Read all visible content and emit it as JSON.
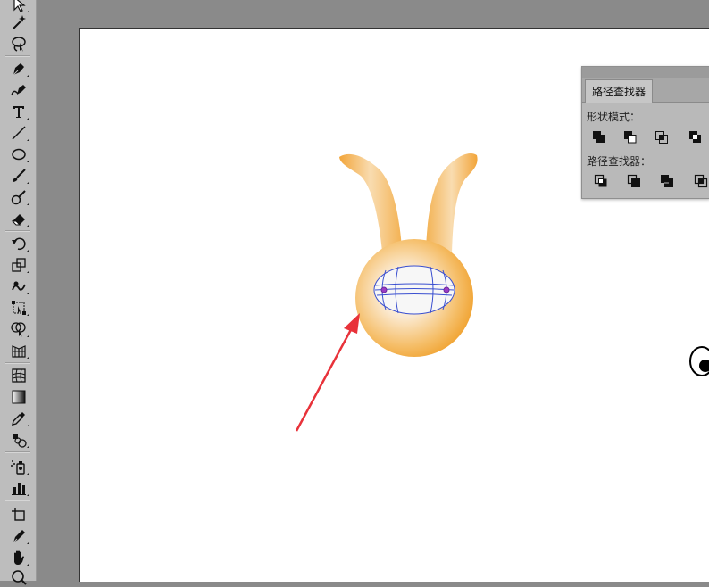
{
  "pathfinder": {
    "tab_label": "路径查找器",
    "shape_modes_label": "形状模式：",
    "pathfinders_label": "路径查找器："
  },
  "toolbar": {
    "tools": [
      "selection-tool",
      "magic-wand-tool",
      "lasso-tool",
      "pen-tool",
      "curvature-tool",
      "type-tool",
      "line-segment-tool",
      "ellipse-tool",
      "paintbrush-tool",
      "blob-brush-tool",
      "eraser-tool",
      "rotate-tool",
      "scale-tool",
      "warp-tool",
      "free-transform-tool",
      "shape-builder-tool",
      "perspective-grid-tool",
      "mesh-tool",
      "gradient-tool",
      "eyedropper-tool",
      "blend-tool",
      "symbol-sprayer-tool",
      "column-graph-tool",
      "artboard-tool",
      "slice-tool",
      "hand-tool",
      "zoom-tool"
    ]
  },
  "colors": {
    "bunny_orange": "#f2a93b",
    "mesh_lines": "#3a4fd0",
    "arrow_red": "#e8323a",
    "panel_bg": "#b9b9b9"
  }
}
